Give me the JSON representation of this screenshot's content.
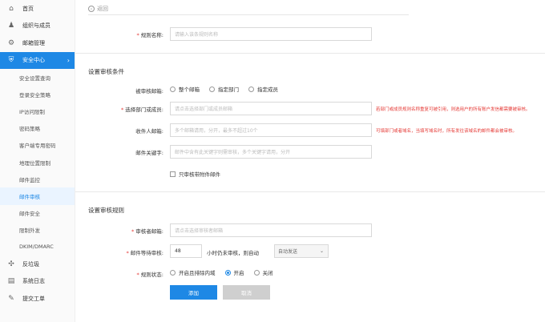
{
  "sidebar": {
    "items_top": [
      {
        "label": "首页",
        "icon": "home-icon",
        "glyph": "⌂"
      },
      {
        "label": "组织与成员",
        "icon": "users-icon",
        "glyph": "♟"
      },
      {
        "label": "邮箱管理",
        "icon": "gear-icon",
        "glyph": "⚙"
      },
      {
        "label": "安全中心",
        "icon": "shield-icon",
        "glyph": "⛨"
      }
    ],
    "sub_items": [
      "安全设置查询",
      "登录安全策略",
      "IP访问限制",
      "密码策略",
      "客户端专用密码",
      "地理位置限制",
      "邮件监控",
      "邮件审核",
      "邮件安全",
      "限制外发",
      "DKIM/DMARC"
    ],
    "items_bottom": [
      {
        "label": "反垃圾",
        "icon": "spam-icon",
        "glyph": "✣"
      },
      {
        "label": "系统日志",
        "icon": "log-icon",
        "glyph": "▤"
      },
      {
        "label": "提交工单",
        "icon": "ticket-icon",
        "glyph": "✎"
      }
    ]
  },
  "back_label": "返回",
  "rule_name": {
    "label": "规则名称:",
    "placeholder": "请输入该条规则名称"
  },
  "section1": {
    "title": "设置审核条件",
    "monitored_label": "被审核邮箱:",
    "monitored_options": [
      "整个邮箱",
      "指定部门",
      "指定成员"
    ],
    "dept_label": "选择部门或成员:",
    "dept_placeholder": "请点击选择部门或成员邮箱",
    "dept_hint": "若部门或成员规则名称重复可被引用，则选用户的所有账户发信都需要被审核。",
    "recipient_label": "收件人邮箱:",
    "recipient_placeholder": "多个邮箱请用，分开，最多不超过10个",
    "recipient_hint": "可填部门或者域名，当填写域名时，所有发往该域名的邮件都会被审核。",
    "keyword_label": "邮件关键字:",
    "keyword_placeholder": "邮件中含有此关键字则需审核，多个关键字请用，分开",
    "attach_label": "只审核带附件邮件"
  },
  "section2": {
    "title": "设置审核规则",
    "auditor_label": "审核者邮箱:",
    "auditor_placeholder": "请点击选择审核者邮箱",
    "wait_label": "邮件等待审核:",
    "wait_value": "48",
    "wait_suffix": "小时仍未审核，则自动",
    "auto_select": "自动发送",
    "status_label": "规则状态:",
    "status_options": [
      "开启且排除内域",
      "开启",
      "关闭"
    ]
  },
  "buttons": {
    "add": "添加",
    "cancel": "取消"
  },
  "colors": {
    "accent": "#1e88e5",
    "required": "#e53935"
  }
}
